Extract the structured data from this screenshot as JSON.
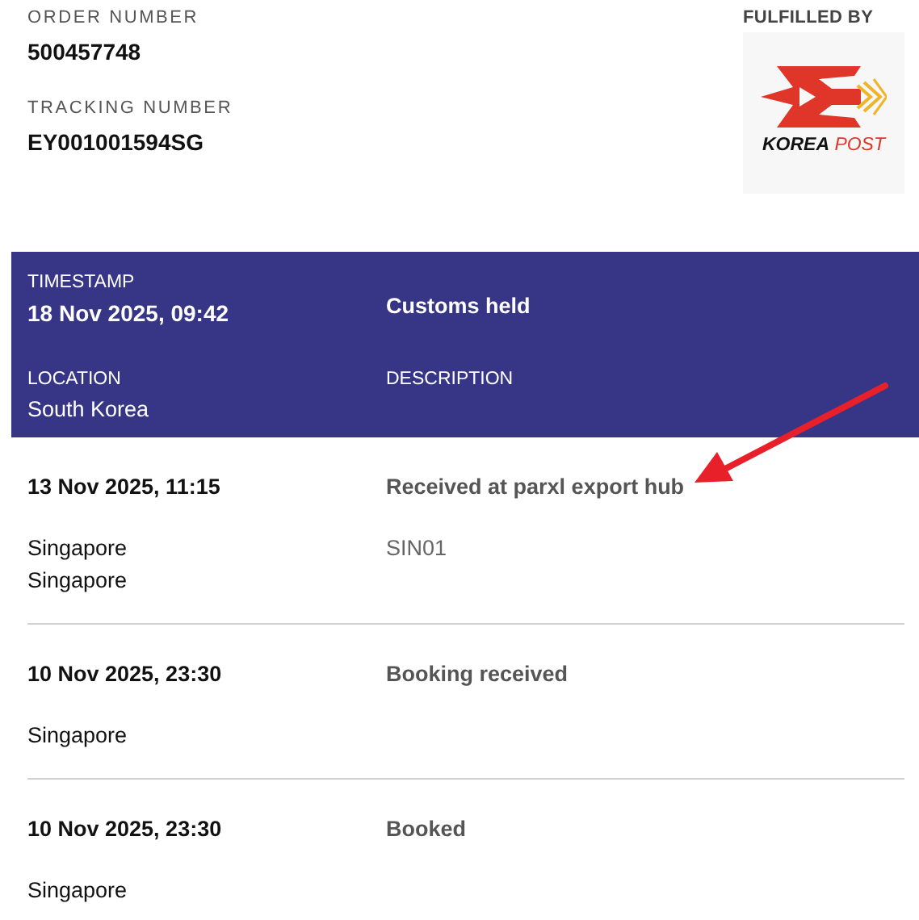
{
  "order": {
    "order_label": "ORDER NUMBER",
    "order_number": "500457748",
    "tracking_label": "TRACKING NUMBER",
    "tracking_number": "EY001001594SG"
  },
  "carrier": {
    "label": "FULFILLED BY",
    "logo_words": [
      "KOREA",
      "POST"
    ]
  },
  "events": [
    {
      "kind": "latest",
      "timestamp_label": "TIMESTAMP",
      "timestamp": "18 Nov 2025, 09:42",
      "status": "Customs held",
      "location_label": "LOCATION",
      "location": [
        "South Korea"
      ],
      "description_label": "DESCRIPTION"
    },
    {
      "kind": "past",
      "timestamp": "13 Nov 2025, 11:15",
      "status": "Received at parxl export hub",
      "location": [
        "Singapore",
        "Singapore"
      ],
      "detail": "SIN01"
    },
    {
      "kind": "past",
      "timestamp": "10 Nov 2025, 23:30",
      "status": "Booking received",
      "location": [
        "Singapore"
      ]
    },
    {
      "kind": "past",
      "timestamp": "10 Nov 2025, 23:30",
      "status": "Booked",
      "location": [
        "Singapore"
      ]
    }
  ],
  "annotation_arrow": true
}
